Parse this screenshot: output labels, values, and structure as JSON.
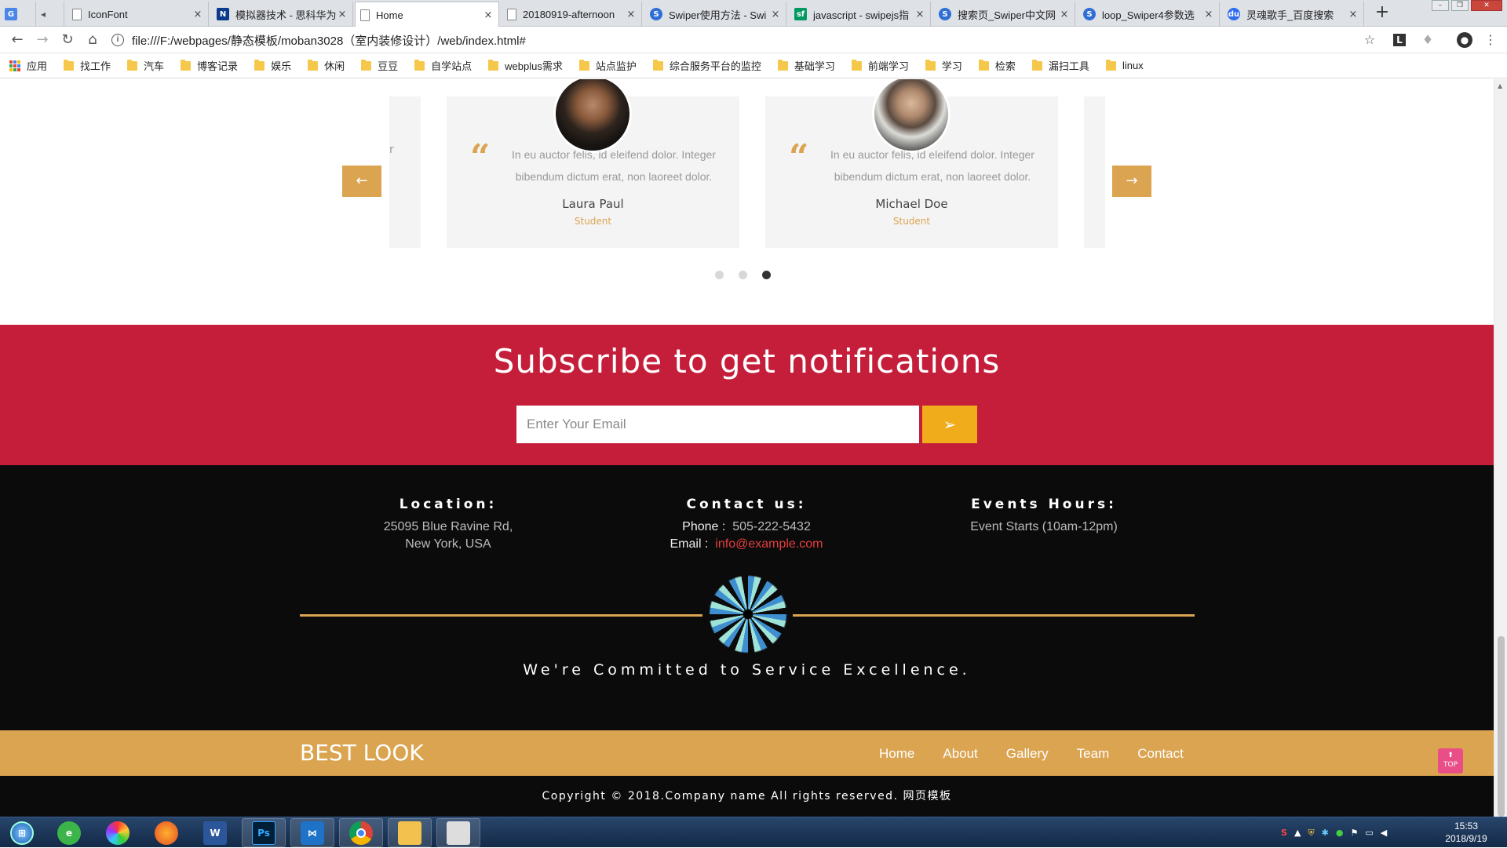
{
  "browser": {
    "tabs": [
      {
        "title": "IconFont",
        "icon": "page"
      },
      {
        "title": "模拟器技术 - 思科华为",
        "icon": "n"
      },
      {
        "title": "Home",
        "icon": "page",
        "active": true
      },
      {
        "title": "20180919-afternoon",
        "icon": "page"
      },
      {
        "title": "Swiper使用方法 - Swi",
        "icon": "s"
      },
      {
        "title": "javascript - swipejs指",
        "icon": "sf"
      },
      {
        "title": "搜索页_Swiper中文网",
        "icon": "s"
      },
      {
        "title": "loop_Swiper4参数选",
        "icon": "s"
      },
      {
        "title": "灵魂歌手_百度搜索",
        "icon": "paw"
      }
    ],
    "tab_close_glyph": "×",
    "new_tab_glyph": "+",
    "url": "file:///F:/webpages/静态模板/moban3028（室内装修设计）/web/index.html#",
    "info_glyph": "i",
    "bookmarks": [
      "应用",
      "找工作",
      "汽车",
      "博客记录",
      "娱乐",
      "休闲",
      "豆豆",
      "自学站点",
      "webplus需求",
      "站点监护",
      "综合服务平台的监控",
      "基础学习",
      "前端学习",
      "学习",
      "检索",
      "漏扫工具",
      "linux"
    ]
  },
  "testimonials": {
    "cards": [
      {
        "quote_mark": "“",
        "text": "In eu auctor felis, id eleifend dolor. Integer bibendum dictum erat, non laoreet dolor.",
        "name": "Laura Paul",
        "role": "Student"
      },
      {
        "quote_mark": "“",
        "text": "In eu auctor felis, id eleifend dolor. Integer bibendum dictum erat, non laoreet dolor.",
        "name": "Michael Doe",
        "role": "Student"
      }
    ],
    "partial_left_text": "r",
    "prev_glyph": "←",
    "next_glyph": "→",
    "active_dot": 3,
    "dot_count": 3
  },
  "subscribe": {
    "title": "Subscribe to get notifications",
    "placeholder": "Enter Your Email",
    "send_glyph": "➢"
  },
  "footer": {
    "location": {
      "heading": "Location:",
      "line1": "25095 Blue Ravine Rd,",
      "line2": "New York, USA"
    },
    "contact": {
      "heading": "Contact us:",
      "phone_label": "Phone :",
      "phone": "505-222-5432",
      "email_label": "Email :",
      "email": "info@example.com"
    },
    "hours": {
      "heading": "Events Hours:",
      "text": "Event Starts (10am-12pm)"
    },
    "tagline": "We're Committed to Service Excellence.",
    "accent_color": "#dba451"
  },
  "navbar": {
    "brand": "BEST LOOK",
    "links": [
      "Home",
      "About",
      "Gallery",
      "Team",
      "Contact"
    ],
    "top_glyph": "⬆",
    "top_label": "TOP"
  },
  "copyright": "Copyright © 2018.Company name All rights reserved. 网页模板",
  "taskbar": {
    "apps": [
      "start",
      "browser-360",
      "color-wheel",
      "firefox",
      "word",
      "photoshop",
      "vscode",
      "chrome",
      "explorer",
      "image-viewer"
    ],
    "ps_label": "Ps",
    "word_label": "W",
    "clock_time": "15:53",
    "clock_date": "2018/9/19"
  },
  "colors": {
    "red_band": "#c41e3a",
    "gold": "#dba451",
    "send_button": "#f0ac1b",
    "dark": "#0b0b0b",
    "email_link": "#e53e3e"
  }
}
